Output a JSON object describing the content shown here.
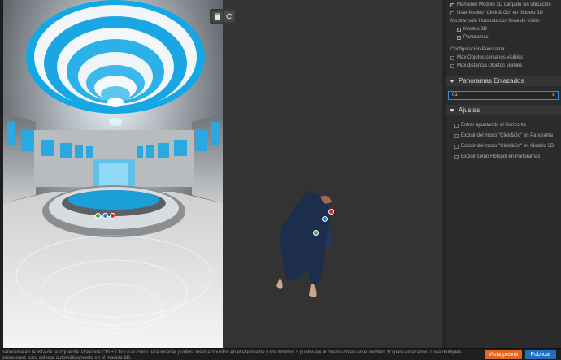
{
  "settings": {
    "keep_model_loaded": "Mantener Modelo 3D cargado sin ubicación",
    "use_click_go": "Usar Modeo \"Click & Go\" en Modelo 3D",
    "show_hotspots_line": "Mostrar sólo Hotspots con línea de visión",
    "show_in_model": "Modelo 3D",
    "show_in_panoramas": "Panoramas"
  },
  "panorama_config": {
    "title": "Configuración Panorama:",
    "max_near_visible": "Max Objetos cercanos visibles",
    "max_distance_visible": "Max distancia Objetos visibles"
  },
  "linked": {
    "title": "Panoramas Enlazados",
    "search_value": "01",
    "clear_symbol": "×"
  },
  "adjust": {
    "title": "Ajustes",
    "enter_pointing_horizon": "Entrar apuntando al Horizonte",
    "exclude_click_pano": "Excluir del modo \"Click&Go\" en Panorama",
    "exclude_click_model": "Excluir del modo \"Click&Go\" en Modelo 3D",
    "exclude_hotspot": "Excluir como Hotspot en Panoramas"
  },
  "footer": {
    "help": "panorama en la lista de la izquierda. Presiona Ctrl + Click o el icono para insertar puntos. Inserta 3puntos en el Panorama y los mismos 3 puntos en el mismo orden en el modelo 3D para enlazarlos. Crea múltiples conexiones para colocar automáticamente en el modelo 3D.",
    "preview_label": "Vista previa",
    "publish_label": "Publicar"
  },
  "toolbar": {
    "delete_icon": "trash-icon",
    "refresh_icon": "refresh-icon"
  },
  "colors": {
    "accent_blue": "#1f6fc2",
    "preview_orange": "#e2661d",
    "marker_green": "#3bb54a",
    "marker_blue": "#2d7fd6",
    "marker_red": "#e0242a"
  }
}
